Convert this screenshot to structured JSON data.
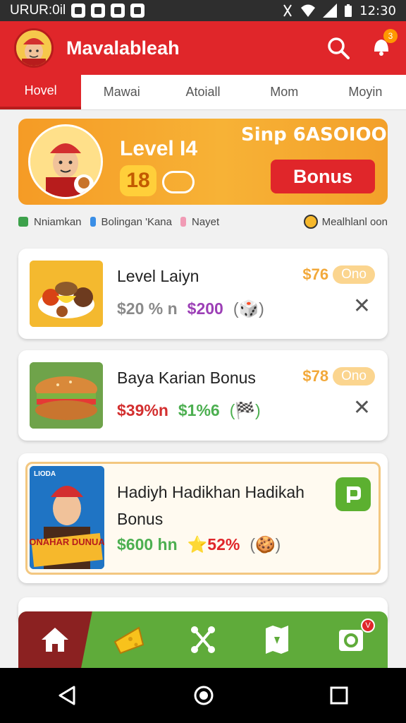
{
  "status_bar": {
    "left_text": "URUR:0il",
    "time": "12:30"
  },
  "app": {
    "title": "Mavalableah",
    "notification_count": "3"
  },
  "tabs": [
    {
      "label": "Hovel",
      "active": true
    },
    {
      "label": "Mawai",
      "active": false
    },
    {
      "label": "Atoiall",
      "active": false
    },
    {
      "label": "Mom",
      "active": false
    },
    {
      "label": "Moyin",
      "active": false
    }
  ],
  "banner": {
    "level": "Level I4",
    "number": "18",
    "promo": "Sinp 6ASOIOO",
    "button": "Bonus"
  },
  "tags": {
    "item1": "Nniamkan",
    "item2": "Bolingan 'Kana",
    "item3": "Nayet",
    "right": "Mealhlanl oon",
    "colors": {
      "item1": "#3da14b",
      "item2": "#3a8ee6",
      "item3": "#f19bb5"
    }
  },
  "cards": [
    {
      "title": "Level Laiyn",
      "price_a": "$20 % n",
      "price_b": "$200",
      "extra": "(🎲)",
      "tag_amount": "$76",
      "tag_pill": "Ono",
      "colors": {
        "a": "#8a8a8a",
        "b": "#9c3fb6"
      }
    },
    {
      "title": "Baya Karian Bonus",
      "price_a": "$39%n",
      "price_b": "$1%6",
      "extra": "(🏁)",
      "tag_amount": "$78",
      "tag_pill": "Ono",
      "colors": {
        "a": "#d32f2f",
        "b": "#4caf50"
      }
    },
    {
      "title_line1": "Hadiyh Hadikhan Hadikah",
      "title_line2": "Bonus",
      "price_a": "$600 hn",
      "price_b": "⭐52%",
      "extra": "(🍪)",
      "thumb_text": "HONAHAR DUNUAN",
      "thumb_top": "LIODA",
      "colors": {
        "a": "#4caf50",
        "b": "#e0262a"
      }
    }
  ],
  "bottom_nav": {
    "badge": "V"
  },
  "colors": {
    "primary": "#e0262a",
    "accent": "#f6a623",
    "green": "#5fab3a"
  }
}
